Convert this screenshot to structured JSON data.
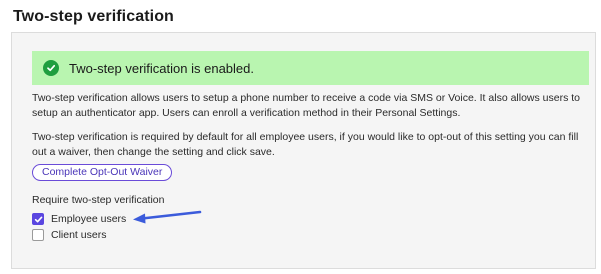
{
  "header": {
    "title": "Two-step verification"
  },
  "banner": {
    "text": "Two-step verification is enabled.",
    "icon": "check-circle-icon",
    "color": "#b9f5b0"
  },
  "description": {
    "paragraph1": "Two-step verification allows users to setup a phone number to receive a code via SMS or Voice. It also allows users to setup an authenticator app. Users can enroll a verification method in their Personal Settings.",
    "paragraph2": "Two-step verification is required by default for all employee users, if you would like to opt-out of this setting you can fill out a waiver, then change the setting and click save."
  },
  "waiver_button": {
    "label": "Complete Opt-Out Waiver"
  },
  "require": {
    "label": "Require two-step verification",
    "options": [
      {
        "label": "Employee users",
        "checked": true
      },
      {
        "label": "Client users",
        "checked": false
      }
    ]
  },
  "annotation": {
    "icon": "arrow-icon",
    "color": "#3b5bdb"
  }
}
